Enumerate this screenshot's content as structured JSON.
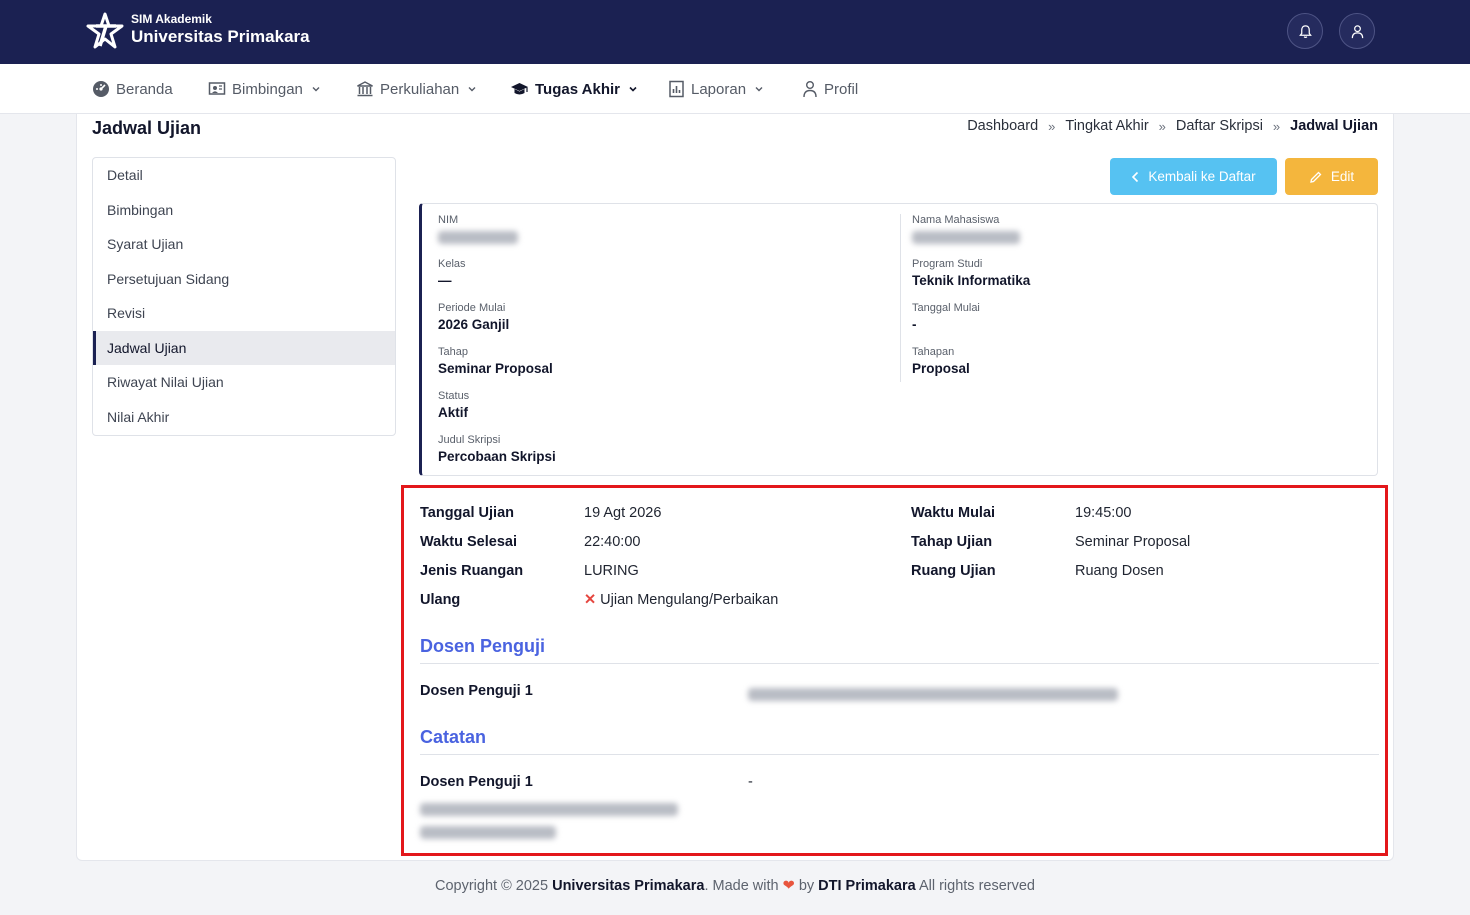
{
  "header": {
    "brand_sub": "SIM Akademik",
    "brand_main": "Universitas Primakara",
    "notifications_icon": "bell-icon",
    "profile_icon": "user-icon"
  },
  "nav": {
    "items": [
      {
        "label": "Beranda",
        "icon": "dashboard-icon"
      },
      {
        "label": "Bimbingan",
        "icon": "classroom-icon"
      },
      {
        "label": "Perkuliahan",
        "icon": "institution-icon"
      },
      {
        "label": "Tugas Akhir",
        "icon": "graduation-cap-icon",
        "active": true
      },
      {
        "label": "Laporan",
        "icon": "report-icon"
      },
      {
        "label": "Profil",
        "icon": "user-icon"
      }
    ]
  },
  "page": {
    "title": "Jadwal Ujian",
    "breadcrumb": [
      "Dashboard",
      "Tingkat Akhir",
      "Daftar Skripsi",
      "Jadwal Ujian"
    ],
    "breadcrumb_sep": "»"
  },
  "sidebar": {
    "items": [
      {
        "label": "Detail"
      },
      {
        "label": "Bimbingan"
      },
      {
        "label": "Syarat Ujian"
      },
      {
        "label": "Persetujuan Sidang"
      },
      {
        "label": "Revisi"
      },
      {
        "label": "Jadwal Ujian",
        "active": true
      },
      {
        "label": "Riwayat Nilai Ujian"
      },
      {
        "label": "Nilai Akhir"
      }
    ]
  },
  "actions": {
    "back_label": "Kembali ke Daftar",
    "edit_label": "Edit"
  },
  "student": {
    "nim_label": "NIM",
    "nama_label": "Nama Mahasiswa",
    "kelas_label": "Kelas",
    "kelas_value": "—",
    "prodi_label": "Program Studi",
    "prodi_value": "Teknik Informatika",
    "periode_label": "Periode Mulai",
    "periode_value": "2026 Ganjil",
    "tanggal_mulai_label": "Tanggal Mulai",
    "tanggal_mulai_value": "-",
    "tahap_label": "Tahap",
    "tahap_value": "Seminar Proposal",
    "tahapan_label": "Tahapan",
    "tahapan_value": "Proposal",
    "status_label": "Status",
    "status_value": "Aktif",
    "judul_label": "Judul Skripsi",
    "judul_value": "Percobaan Skripsi"
  },
  "schedule": {
    "tanggal_label": "Tanggal Ujian",
    "tanggal_value": "19 Agt 2026",
    "waktu_mulai_label": "Waktu Mulai",
    "waktu_mulai_value": "19:45:00",
    "waktu_selesai_label": "Waktu Selesai",
    "waktu_selesai_value": "22:40:00",
    "tahap_ujian_label": "Tahap Ujian",
    "tahap_ujian_value": "Seminar Proposal",
    "jenis_ruangan_label": "Jenis Ruangan",
    "jenis_ruangan_value": "LURING",
    "ruang_ujian_label": "Ruang Ujian",
    "ruang_ujian_value": "Ruang Dosen",
    "ulang_label": "Ulang",
    "ulang_mark": "✕",
    "ulang_value": "Ujian Mengulang/Perbaikan"
  },
  "examiners": {
    "title": "Dosen Penguji",
    "penguji_1_label": "Dosen Penguji 1"
  },
  "notes": {
    "title": "Catatan",
    "penguji_1_label": "Dosen Penguji 1",
    "penguji_1_value": "-"
  },
  "footer": {
    "copyright": "Copyright © 2025",
    "university": "Universitas Primakara",
    "made_with": ". Made with",
    "heart": "❤",
    "by": "by",
    "org": "DTI Primakara",
    "rights": "All rights reserved"
  },
  "colors": {
    "header_bg": "#1b2152",
    "accent_blue": "#4a63e0",
    "back_button": "#56c2f2",
    "edit_button": "#f4b63d",
    "highlight_border": "#e3171b"
  }
}
